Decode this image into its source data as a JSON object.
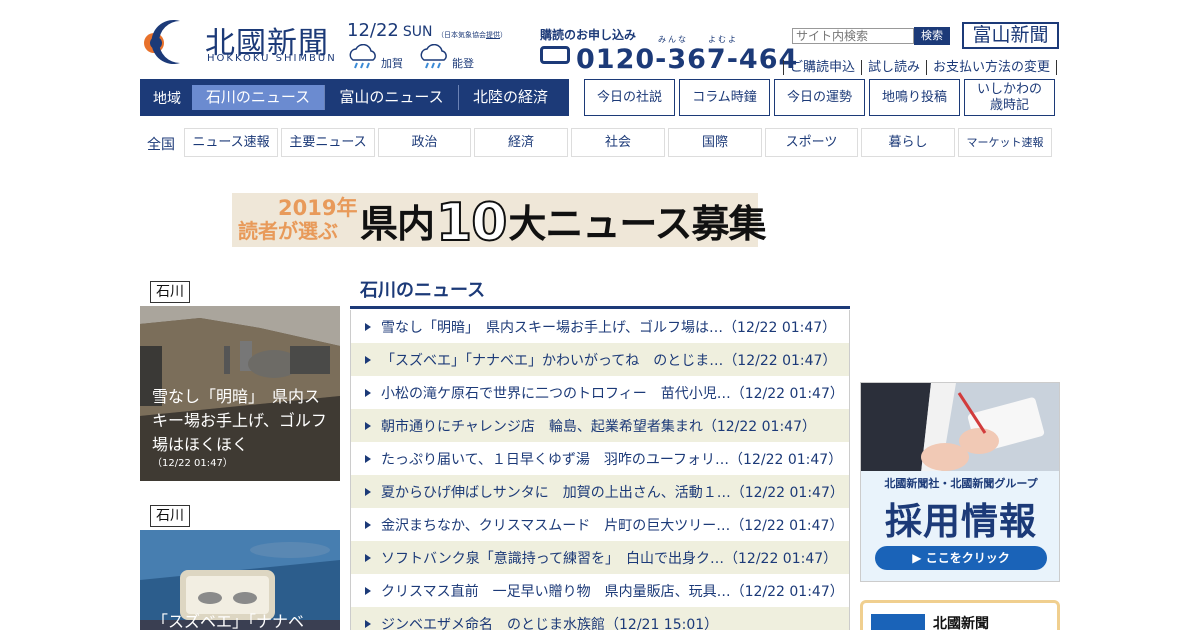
{
  "header": {
    "logo_text": "北國新聞",
    "logo_sub": "HOKKOKU SHIMBUN",
    "date": "12/22",
    "weekday": "SUN",
    "jma_note_prefix": "（日本気象協会",
    "jma_link": "提供",
    "jma_note_suffix": "）",
    "weather": [
      {
        "area": "加賀",
        "icon": "rain-cloud-icon"
      },
      {
        "area": "能登",
        "icon": "rain-cloud-icon"
      }
    ],
    "subscribe_title": "購読のお申し込み",
    "ruby": "みんな　　よむよ",
    "phone": "0120-367-464",
    "search_placeholder": "サイト内検索",
    "search_button": "検索",
    "toyama_logo": "富山新聞",
    "links": [
      "ご購読申込",
      "試し読み",
      "お支払い方法の変更"
    ]
  },
  "region_nav": {
    "label": "地域",
    "tabs": [
      "石川のニュース",
      "富山のニュース",
      "北陸の経済"
    ],
    "active": 0
  },
  "feature_buttons": [
    "今日の社説",
    "コラム時鐘",
    "今日の運勢",
    "地鳴り投稿",
    "いしかわの\n歳時記"
  ],
  "category_nav": {
    "label": "全国",
    "items": [
      "ニュース速報",
      "主要ニュース",
      "政治",
      "経済",
      "社会",
      "国際",
      "スポーツ",
      "暮らし",
      "マーケット速報"
    ]
  },
  "banner": {
    "year": "2019年",
    "readers": "読者が選ぶ",
    "title_pre": "県内",
    "title_num": "10",
    "title_post": "大ニュース募集"
  },
  "cards": [
    {
      "tag": "石川",
      "caption": "雪なし「明暗」　県内スキー場お手上げ、ゴルフ場はほくほく",
      "time": "（12/22 01:47）"
    },
    {
      "tag": "石川",
      "caption": "「スズベエ」「ナナベ"
    }
  ],
  "news": {
    "heading": "石川のニュース",
    "items": [
      {
        "title": "雪なし「明暗」　県内スキー場お手上げ、ゴルフ場は…",
        "time": "（12/22 01:47）"
      },
      {
        "title": "「スズベエ」「ナナベエ」かわいがってね　のとじま…",
        "time": "（12/22 01:47）"
      },
      {
        "title": "小松の滝ケ原石で世界に二つのトロフィー　苗代小児…",
        "time": "（12/22 01:47）"
      },
      {
        "title": "朝市通りにチャレンジ店　輪島、起業希望者集まれ",
        "time": "（12/22 01:47）"
      },
      {
        "title": "たっぷり届いて、１日早くゆず湯　羽咋のユーフォリ…",
        "time": "（12/22 01:47）"
      },
      {
        "title": "夏からひげ伸ばしサンタに　加賀の上出さん、活動１…",
        "time": "（12/22 01:47）"
      },
      {
        "title": "金沢まちなか、クリスマスムード　片町の巨大ツリー…",
        "time": "（12/22 01:47）"
      },
      {
        "title": "ソフトバンク泉「意識持って練習を」　白山で出身ク…",
        "time": "（12/22 01:47）"
      },
      {
        "title": "クリスマス直前　一足早い贈り物　県内量販店、玩具…",
        "time": "（12/22 01:47）"
      },
      {
        "title": "ジンベエザメ命名　のとじま水族館",
        "time": "（12/21 15:01）"
      }
    ]
  },
  "ads": {
    "recruit_company": "北國新聞社・北國新聞グループ",
    "recruit_title": "採用情報",
    "recruit_button": "▶ ここをクリック",
    "shimbun_name": "北國新聞"
  },
  "colors": {
    "brand_navy": "#1c3a78",
    "active_tab": "#6b8bd0",
    "stripe": "#efefde",
    "banner_orange": "#e89a5a"
  }
}
